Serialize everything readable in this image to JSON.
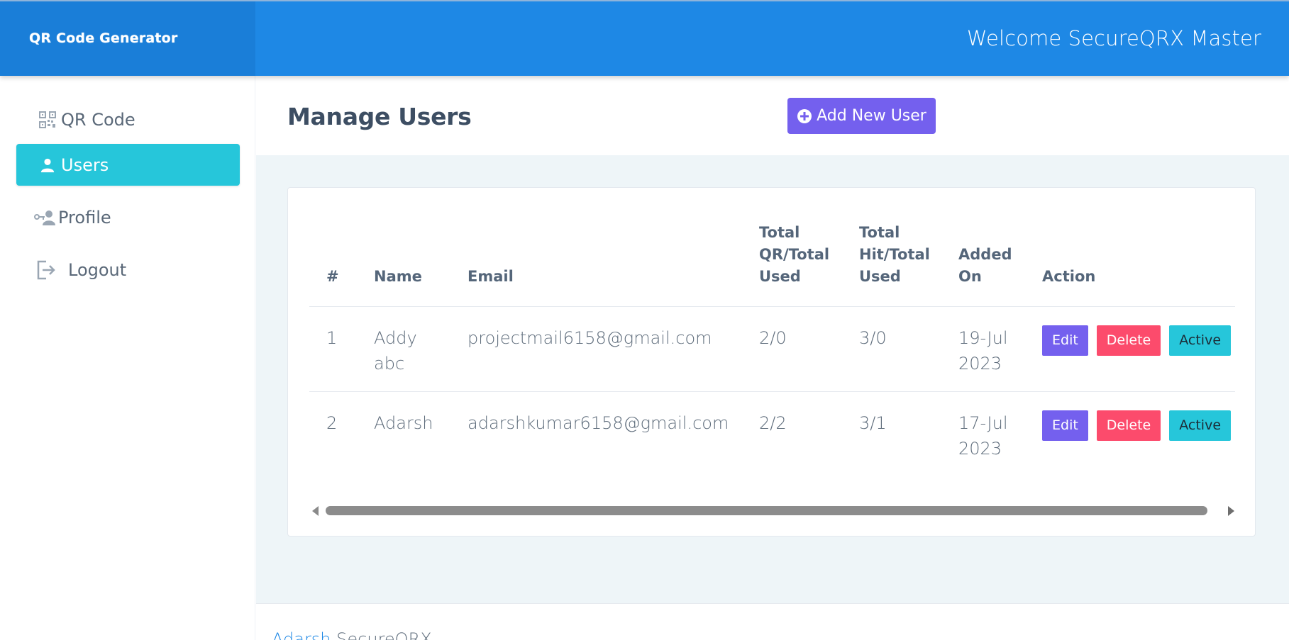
{
  "header": {
    "brand": "QR Code Generator",
    "welcome": "Welcome SecureQRX Master"
  },
  "sidebar": {
    "items": [
      {
        "label": "QR Code",
        "icon": "qr-code-icon",
        "active": false
      },
      {
        "label": "Users",
        "icon": "user-icon",
        "active": true
      },
      {
        "label": "Profile",
        "icon": "user-key-icon",
        "active": false
      },
      {
        "label": "Logout",
        "icon": "logout-icon",
        "active": false
      }
    ]
  },
  "main": {
    "title": "Manage Users",
    "add_button": "Add New User",
    "table": {
      "columns": [
        "#",
        "Name",
        "Email",
        "Total QR/Total Used",
        "Total Hit/Total Used",
        "Added On",
        "Action"
      ],
      "rows": [
        {
          "num": "1",
          "name": "Addy abc",
          "email": "projectmail6158@gmail.com",
          "qr": "2/0",
          "hit": "3/0",
          "added": "19-Jul 2023",
          "edit": "Edit",
          "delete": "Delete",
          "status": "Active"
        },
        {
          "num": "2",
          "name": "Adarsh",
          "email": "adarshkumar6158@gmail.com",
          "qr": "2/2",
          "hit": "3/1",
          "added": "17-Jul 2023",
          "edit": "Edit",
          "delete": "Delete",
          "status": "Active"
        }
      ]
    }
  },
  "footer": {
    "link": "Adarsh",
    "text": " SecureQRX"
  },
  "colors": {
    "topbar": "#1e88e5",
    "brand_bg": "#1a7ed8",
    "active_nav": "#26c6da",
    "primary": "#7460ee",
    "danger": "#fc4b6c",
    "info": "#26c6da",
    "page_bg": "#eef5f8"
  }
}
